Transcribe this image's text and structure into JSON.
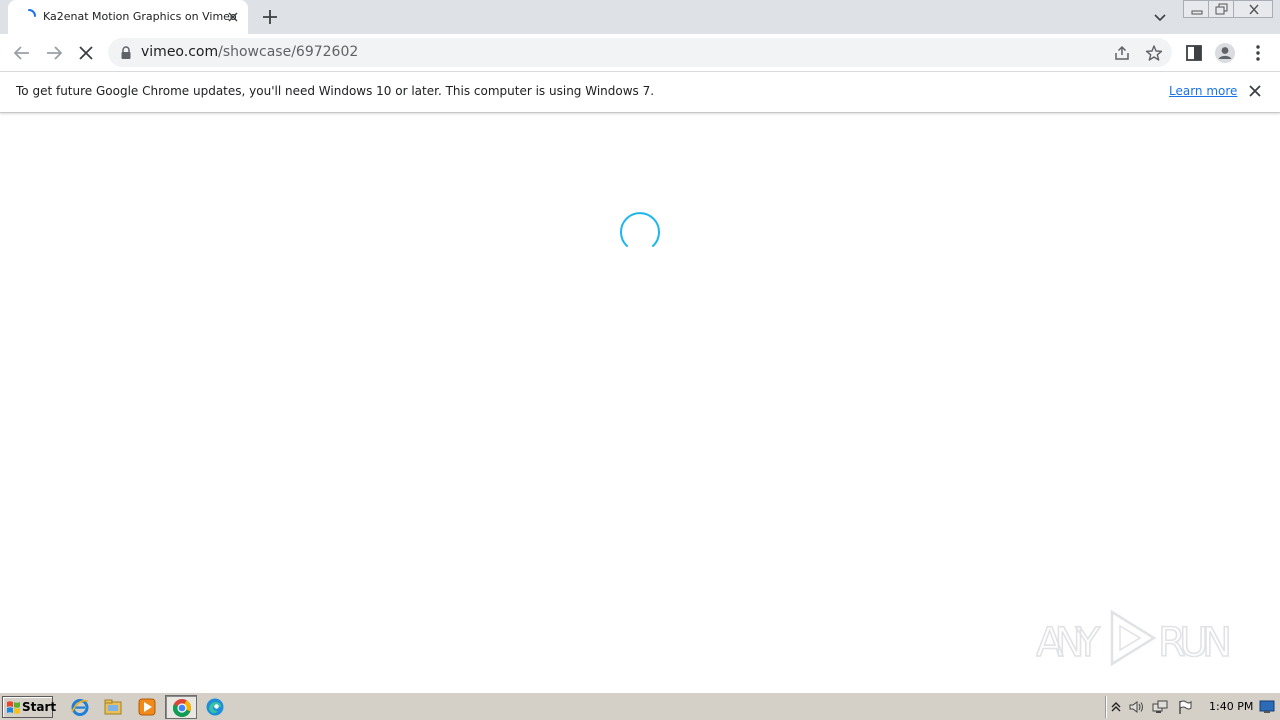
{
  "browser": {
    "tab": {
      "title": "Ka2enat Motion Graphics on Vimeo"
    },
    "omnibox": {
      "host": "vimeo.com",
      "path": "/showcase/6972602"
    }
  },
  "infobar": {
    "message": "To get future Google Chrome updates, you'll need Windows 10 or later. This computer is using Windows 7.",
    "link": "Learn more"
  },
  "page": {
    "state": "loading",
    "spinner_color": "#1ab7ea",
    "watermark": "ANY RUN"
  },
  "taskbar": {
    "start_label": "Start",
    "clock": "1:40 PM"
  },
  "colors": {
    "tabstrip": "#dee1e6",
    "omnibox": "#f1f3f4",
    "link": "#1a73e8",
    "taskbar": "#d4d0c8"
  }
}
